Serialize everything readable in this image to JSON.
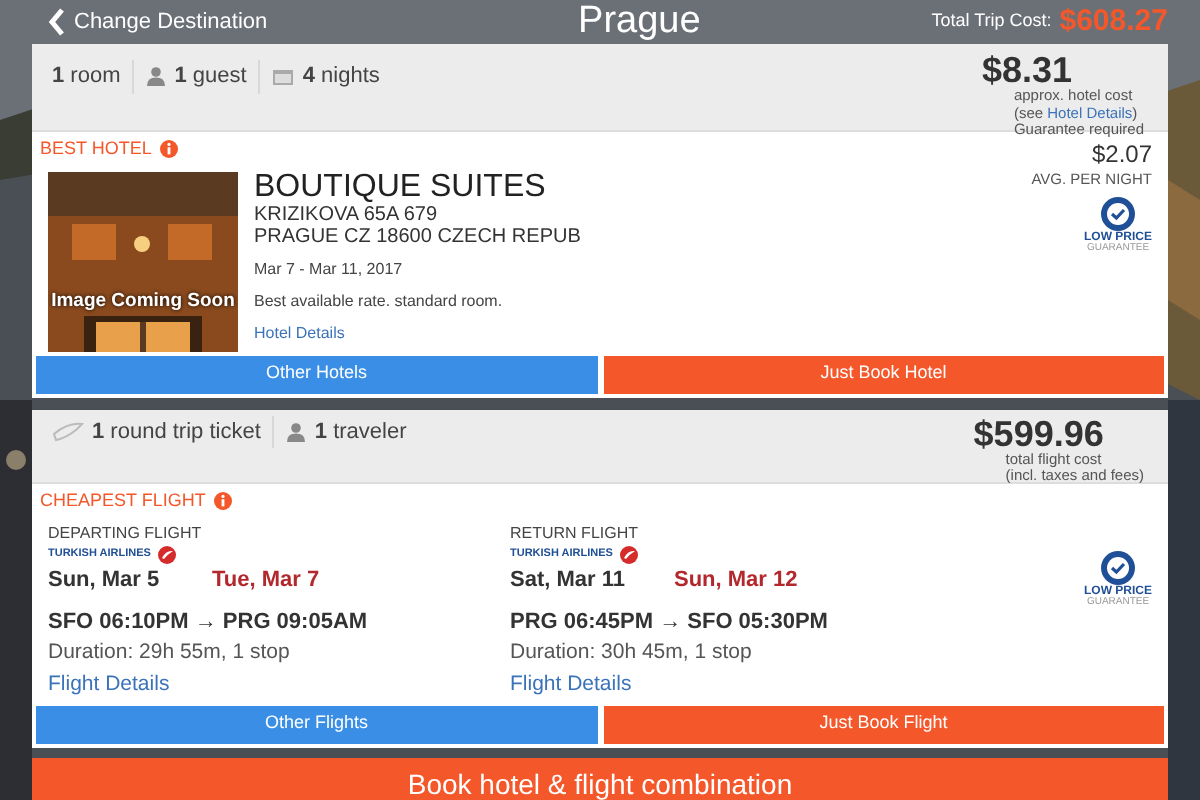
{
  "header": {
    "back_label": "Change Destination",
    "title": "Prague",
    "total_label": "Total Trip Cost:",
    "total": "$608.27"
  },
  "hotel": {
    "summary": [
      {
        "kind": "room",
        "count": "1",
        "label": "room"
      },
      {
        "kind": "guest",
        "count": "1",
        "label": "guest"
      },
      {
        "kind": "nights",
        "count": "4",
        "label": "nights"
      }
    ],
    "price": "$8.31",
    "price_note": "approx. hotel cost",
    "details_note": {
      "before": "(see ",
      "link": "Hotel Details",
      "after": ")"
    },
    "guarantee_note": "Guarantee required",
    "section_label": "BEST HOTEL",
    "image_overlay": "Image Coming Soon",
    "name": "BOUTIQUE SUITES",
    "address_lines": [
      "KRIZIKOVA 65A 679",
      "PRAGUE CZ 18600 CZECH REPUB"
    ],
    "dates": "Mar 7 - Mar 11, 2017",
    "rate": "Best available rate. standard room.",
    "details_link": "Hotel Details",
    "nightly_price": "$2.07",
    "nightly_label": "AVG. PER NIGHT",
    "badge": [
      "LOW PRICE",
      "GUARANTEE"
    ],
    "buttons": [
      {
        "label": "Other Hotels",
        "kind": "secondary"
      },
      {
        "label": "Just Book Hotel",
        "kind": "primary"
      }
    ]
  },
  "flight": {
    "summary": [
      {
        "kind": "ticket",
        "count": "1",
        "label": "round trip ticket"
      },
      {
        "kind": "traveler",
        "count": "1",
        "label": "traveler"
      }
    ],
    "price": "$599.96",
    "price_notes": [
      "total flight cost",
      "(incl. taxes and fees)"
    ],
    "section_label": "CHEAPEST FLIGHT",
    "legs": [
      {
        "heading": "DEPARTING FLIGHT",
        "airline": "TURKISH AIRLINES",
        "depart_date": "Sun, Mar 5",
        "arrive_date": "Tue, Mar 7",
        "route": "SFO 06:10PM → PRG 09:05AM",
        "duration": "Duration: 29h 55m, 1 stop",
        "details_link": "Flight Details"
      },
      {
        "heading": "RETURN FLIGHT",
        "airline": "TURKISH AIRLINES",
        "depart_date": "Sat, Mar 11",
        "arrive_date": "Sun, Mar 12",
        "route": "PRG 06:45PM → SFO 05:30PM",
        "duration": "Duration: 30h 45m, 1 stop",
        "details_link": "Flight Details"
      }
    ],
    "badge": [
      "LOW PRICE",
      "GUARANTEE"
    ],
    "buttons": [
      {
        "label": "Other Flights",
        "kind": "secondary"
      },
      {
        "label": "Just Book Flight",
        "kind": "primary"
      }
    ]
  },
  "combo_button": "Book hotel & flight combination"
}
